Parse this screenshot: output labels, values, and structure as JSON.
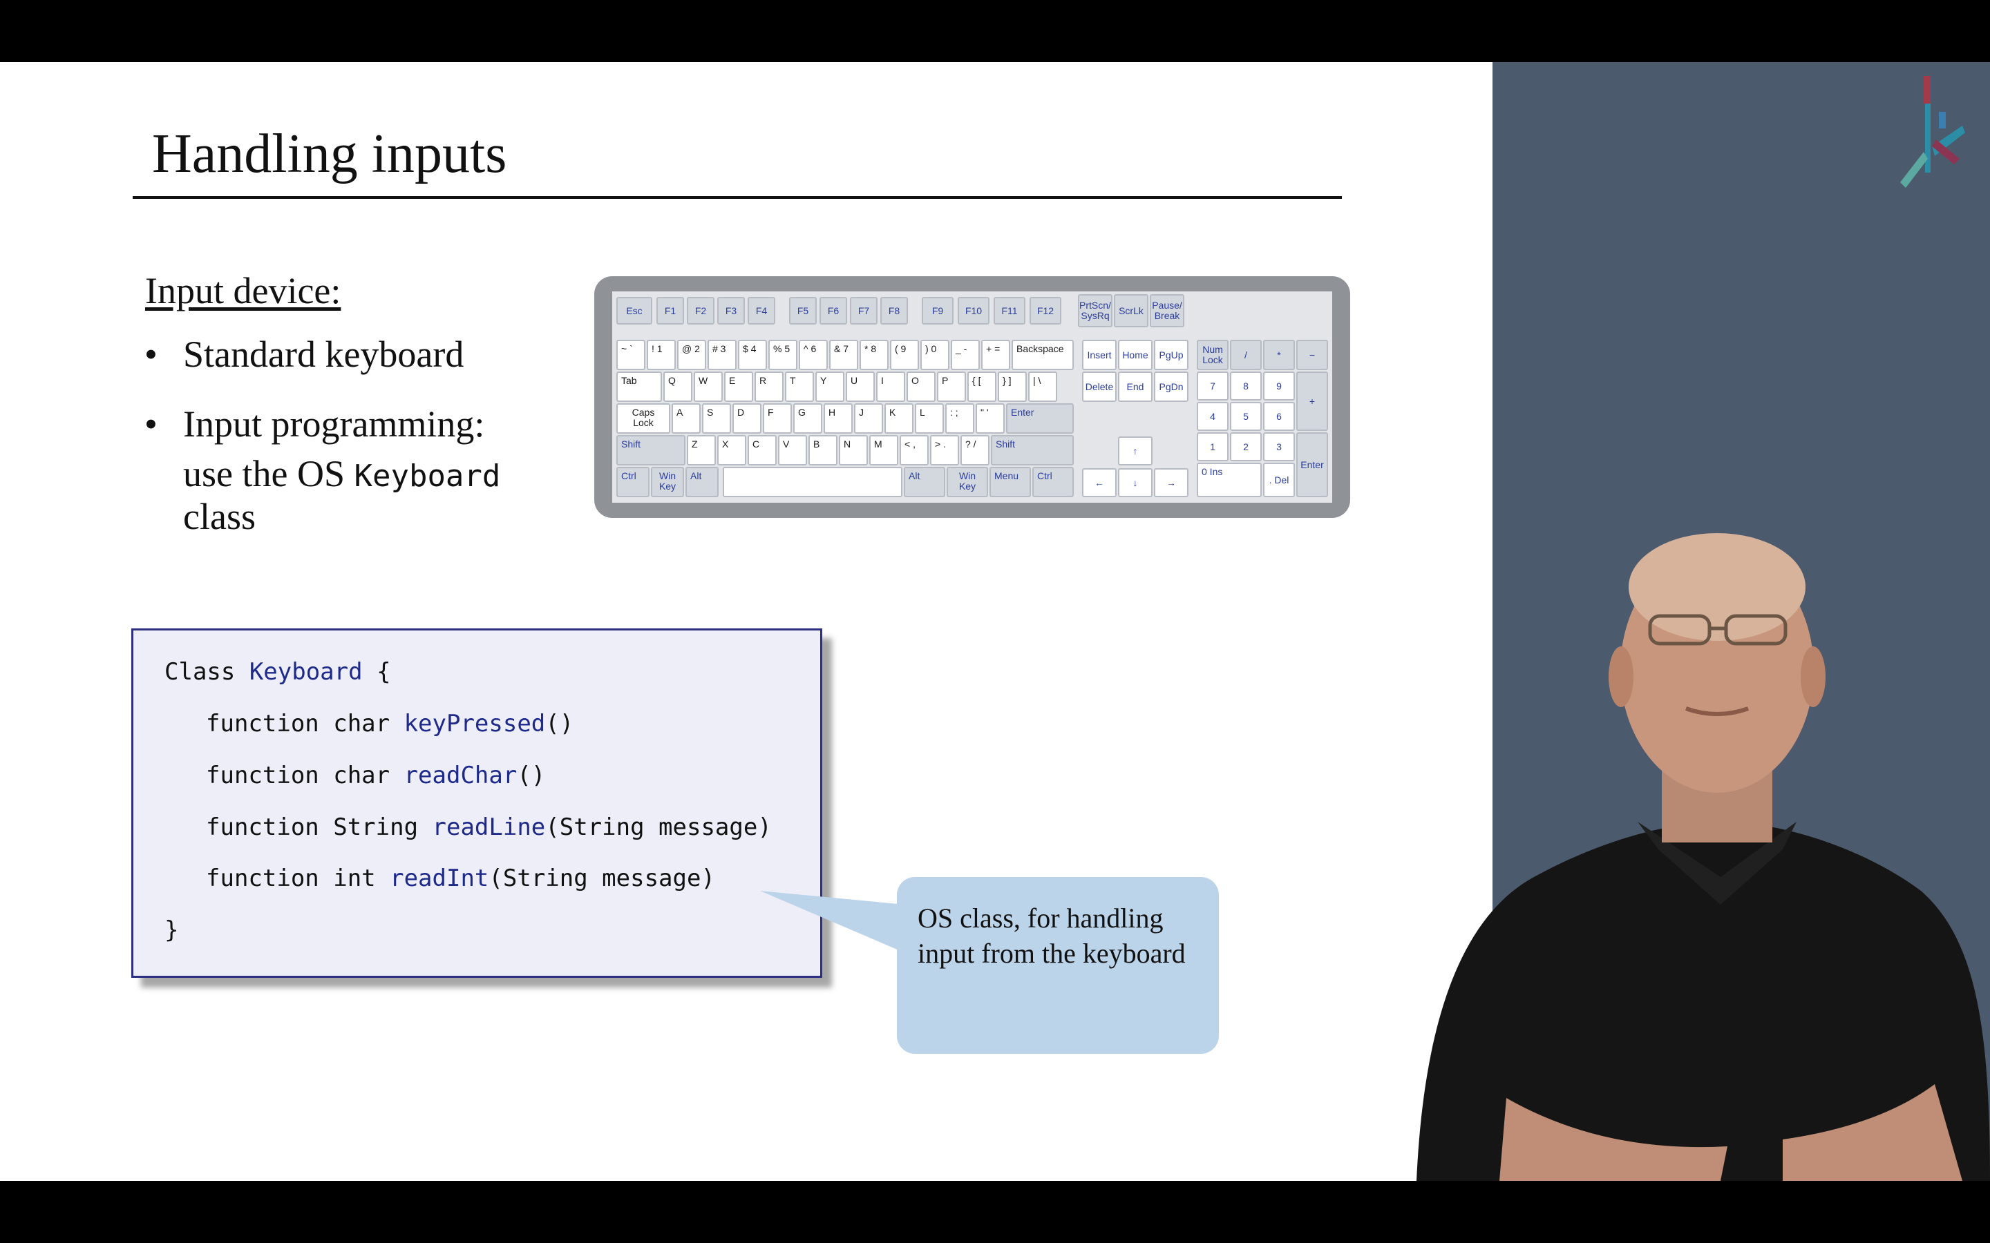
{
  "slide": {
    "title": "Handling inputs",
    "subheading": "Input device:",
    "bullets": [
      {
        "text": "Standard keyboard"
      },
      {
        "text_line1": "Input programming:",
        "text_line2_pre": "use the OS ",
        "text_line2_code": "Keyboard",
        "text_line3": "class"
      }
    ],
    "code": {
      "line1_kw": "Class ",
      "line1_name": "Keyboard",
      "line1_tail": " {",
      "methods": [
        {
          "pre": "function char ",
          "name": "keyPressed",
          "args": "()"
        },
        {
          "pre": "function char ",
          "name": "readChar",
          "args": "()"
        },
        {
          "pre": "function String ",
          "name": "readLine",
          "args": "(String message)"
        },
        {
          "pre": "function int ",
          "name": "readInt",
          "args": "(String message)"
        }
      ],
      "close": "}"
    },
    "callout": {
      "line1": "OS class, for handling",
      "line2": "input from the keyboard"
    }
  },
  "keyboard": {
    "function_row": [
      "Esc",
      "F1",
      "F2",
      "F3",
      "F4",
      "F5",
      "F6",
      "F7",
      "F8",
      "F9",
      "F10",
      "F11",
      "F12"
    ],
    "sys_keys": [
      "PrtScn/ SysRq",
      "ScrLk",
      "Pause/ Break"
    ],
    "number_row": [
      "~ `",
      "! 1",
      "@ 2",
      "# 3",
      "$ 4",
      "% 5",
      "^ 6",
      "& 7",
      "* 8",
      "( 9",
      ") 0",
      "_ -",
      "+ ="
    ],
    "backspace": "Backspace",
    "tab": "Tab",
    "qwerty": [
      "Q",
      "W",
      "E",
      "R",
      "T",
      "Y",
      "U",
      "I",
      "O",
      "P",
      "{ [",
      "} ]",
      "| \\"
    ],
    "caps": "Caps Lock",
    "asdf": [
      "A",
      "S",
      "D",
      "F",
      "G",
      "H",
      "J",
      "K",
      "L",
      ": ;",
      "\" '"
    ],
    "enter": "Enter",
    "shift": "Shift",
    "zxcv": [
      "Z",
      "X",
      "C",
      "V",
      "B",
      "N",
      "M",
      "< ,",
      "> .",
      "? /"
    ],
    "bottom_left": [
      "Ctrl",
      "Win Key",
      "Alt"
    ],
    "bottom_right": [
      "Alt",
      "Win Key",
      "Menu",
      "Ctrl"
    ],
    "nav_top": [
      "Insert",
      "Home",
      "PgUp"
    ],
    "nav_bottom": [
      "Delete",
      "End",
      "PgDn"
    ],
    "arrows": [
      "↑",
      "←",
      "↓",
      "→"
    ],
    "numpad_top": [
      "Num Lock",
      "/",
      "*",
      "−"
    ],
    "numpad_789": [
      "7",
      "8",
      "9"
    ],
    "numpad_456": [
      "4",
      "5",
      "6"
    ],
    "numpad_123": [
      "1",
      "2",
      "3"
    ],
    "numpad_plus": "+",
    "numpad_enter": "Enter",
    "numpad_0": "0 Ins",
    "numpad_del": ". Del"
  },
  "colors": {
    "sidebar": "#4b5a6c",
    "code_bg": "#eeeef9",
    "code_border": "#2d2f82",
    "callout_bg": "#bcd4ea",
    "keyword": "#1e2a8a"
  }
}
